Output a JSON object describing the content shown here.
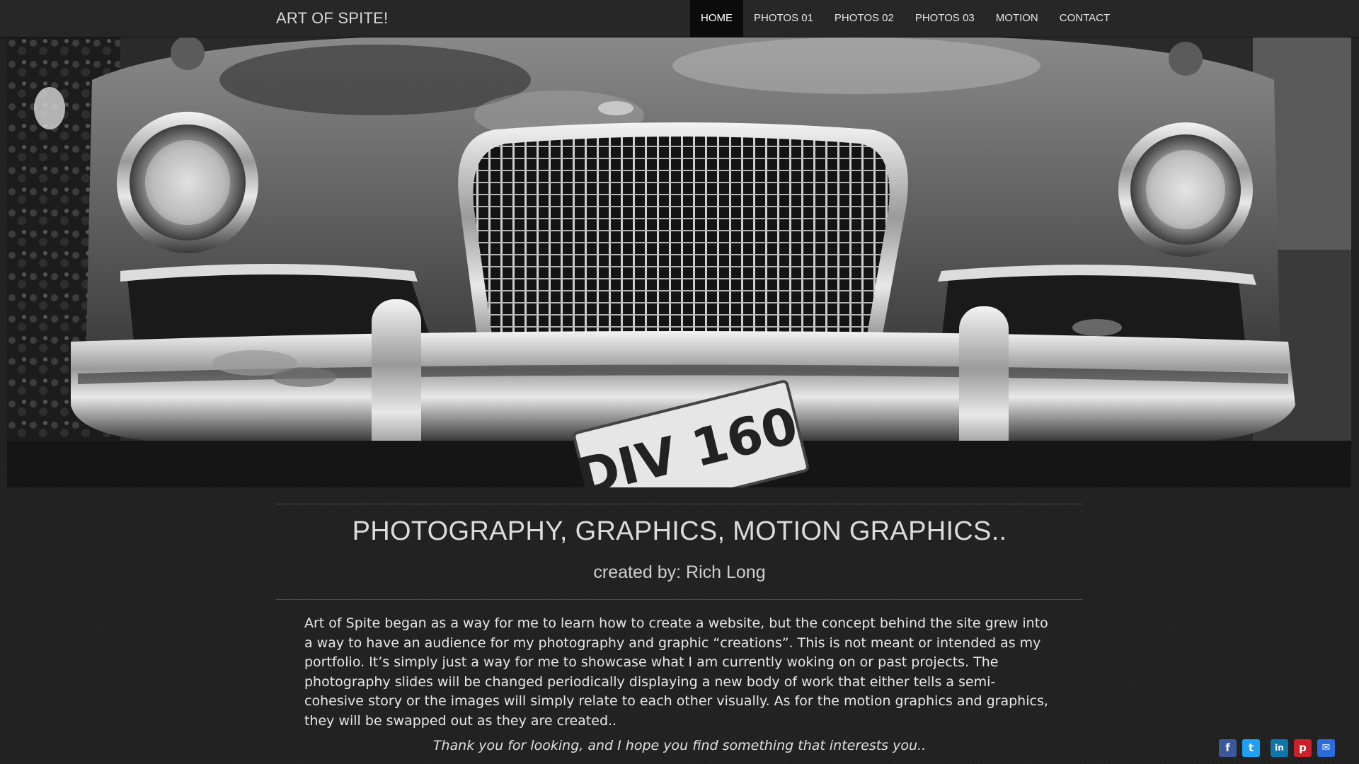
{
  "brand": {
    "title": "ART OF SPITE!"
  },
  "nav": {
    "items": [
      {
        "label": "HOME",
        "active": true
      },
      {
        "label": "PHOTOS 01",
        "active": false
      },
      {
        "label": "PHOTOS 02",
        "active": false
      },
      {
        "label": "PHOTOS 03",
        "active": false
      },
      {
        "label": "MOTION",
        "active": false
      },
      {
        "label": "CONTACT",
        "active": false
      }
    ]
  },
  "hero": {
    "plate_text": "DIV 160"
  },
  "content": {
    "headline": "PHOTOGRAPHY, GRAPHICS, MOTION GRAPHICS..",
    "subline": "created by: Rich Long",
    "body": "Art of Spite began as a way for me to learn how to create a website, but the concept behind the site grew into a way to have an audience for my photography and graphic “creations”. This is not meant or intended as my portfolio. It’s simply just a way for me to showcase what I am currently woking on or past projects. The photography slides will be changed periodically displaying a new body of work that either tells a semi-cohesive story or the images will simply relate to each other visually. As for the motion graphics and graphics, they will be swapped out as they are created..",
    "thanks": "Thank you for looking, and I hope you find something that interests you.."
  },
  "share": {
    "icons": [
      {
        "name": "facebook-icon",
        "glyph": "f",
        "color": "#3b5998"
      },
      {
        "name": "twitter-icon",
        "glyph": "t",
        "color": "#1da1f2"
      },
      {
        "name": "linkedin-icon",
        "glyph": "in",
        "color": "#0e76a8"
      },
      {
        "name": "pinterest-icon",
        "glyph": "p",
        "color": "#cb2027"
      },
      {
        "name": "email-icon",
        "glyph": "✉",
        "color": "#2d6bd8"
      }
    ]
  },
  "colors": {
    "background": "#222222",
    "navbar": "#272727",
    "nav_active": "#0b0b0b",
    "text": "#e8e8e8"
  }
}
